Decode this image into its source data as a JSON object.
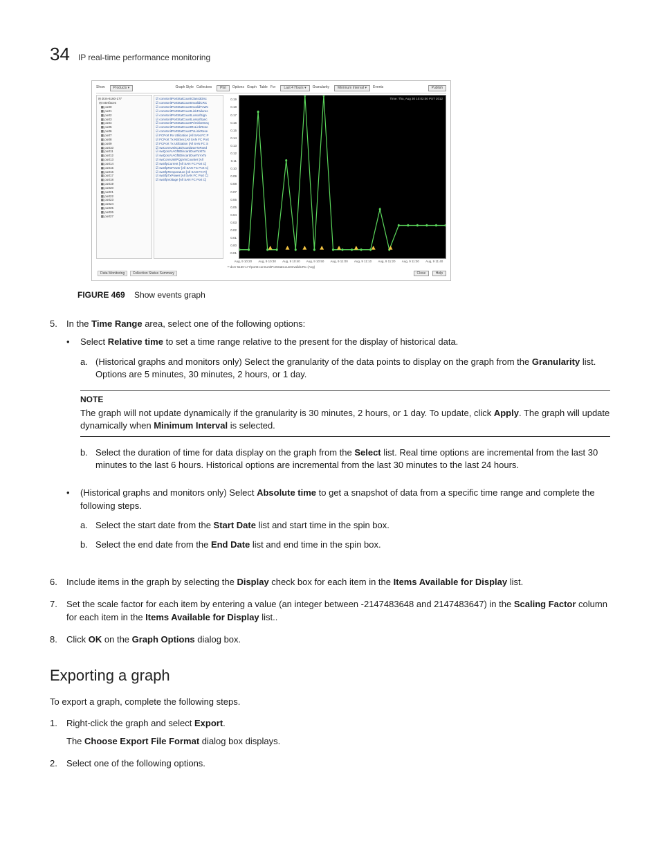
{
  "page_number": "34",
  "header_title": "IP real-time performance monitoring",
  "figure": {
    "toolbar_left": [
      "Show",
      "Products ▾"
    ],
    "toolbar_mid": [
      "Graph Style",
      "Collectors"
    ],
    "toolbar_mid2": "Plot",
    "toolbar_right": [
      "Options",
      "Graph",
      "Table",
      "For",
      "Last 4 Hours ▾",
      "Granularity",
      "Minimum Interval ▾",
      "",
      "Events"
    ],
    "publish_btn": "Publish",
    "time_label": "Time: Thu, Aug 30 10:02:00 PST 2012",
    "tree_root": "dcm-6160-177",
    "tree_group": "Interfaces",
    "tree_ports": [
      "port0",
      "port1",
      "port2",
      "port3",
      "port4",
      "port5",
      "port6",
      "port7",
      "port8",
      "port9",
      "port10",
      "port11",
      "port12",
      "port13",
      "port14",
      "port15",
      "port16",
      "port17",
      "port18",
      "port19",
      "port20",
      "port21",
      "port22",
      "port23",
      "port24",
      "port25",
      "port26",
      "port27"
    ],
    "list_items": [
      "connUnitPortStatCountClass3Disc",
      "connUnitPortStatCountInvalidCRC",
      "connUnitPortStatCountInvalidTxWo",
      "connUnitPortStatCountLinkFailures",
      "connUnitPortStatCountLossofSign",
      "connUnitPortStatCountLossofSync",
      "connUnitPortStatCountPrimitiveSeq",
      "connUnitPortStatCountRxLinkRese",
      "connUnitPortStatCountTxLinkRese",
      "FCPort Rx Utilization [All SAN FC P",
      "FCPort Tx KB/Sec [All SAN FC Port",
      "FCPort Tx Utilization [All SAN FC S",
      "swConnUnitC3DiscardDueToRxed",
      "swQosVcAGfBDiscardDueToXtTo",
      "swQosVcAGfBDiscardDueToYxTo",
      "swConnUnitPQgVmCounter [All",
      "swSfpCurrent [All SAN FC Port C]",
      "swSfpRxPower [All SAN FC Port C]",
      "swSfpTemperature [All SAN FC R]",
      "swSfpTxPower [All SAN FC Port C]",
      "swSfpVoltage [All SAN FC Port C]"
    ],
    "y_ticks": [
      "0.19",
      "0.18",
      "0.17",
      "0.16",
      "0.15",
      "0.14",
      "0.13",
      "0.12",
      "0.11",
      "0.10",
      "0.09",
      "0.08",
      "0.07",
      "0.06",
      "0.05",
      "0.04",
      "0.03",
      "0.02",
      "0.01",
      "0.00",
      "-0.01"
    ],
    "x_ticks": [
      "Aug, 9 10:20",
      "Aug, 9 10:30",
      "Aug, 9 10:40",
      "Aug, 9 10:50",
      "Aug, 9 11:00",
      "Aug, 9 11:10",
      "Aug, 9 11:20",
      "Aug, 9 11:30",
      "Aug, 9 11:40"
    ],
    "legend": "dcm-6160-177/port0:connUnitPortStatCountInvalidCRC (Avg)",
    "tabs": [
      "Data Monitoring",
      "Collection Status Summary"
    ],
    "close_btn": "Close",
    "help_btn": "Help"
  },
  "figcaption_lead": "FIGURE 469",
  "figcaption_text": "Show events graph",
  "chart_data": {
    "type": "line",
    "title": "Show events graph",
    "ylabel": "",
    "ylim": [
      -0.01,
      0.19
    ],
    "series": [
      {
        "name": "dcm-6160-177/port0:connUnitPortStatCountInvalidCRC (Avg)",
        "x": [
          "Aug 9 10:20",
          "Aug 9 10:24",
          "Aug 9 10:27",
          "Aug 9 10:28",
          "Aug 9 10:33",
          "Aug 9 10:40",
          "Aug 9 10:48",
          "Aug 9 10:52",
          "Aug 9 10:55",
          "Aug 9 10:57",
          "Aug 9 11:00",
          "Aug 9 11:03",
          "Aug 9 11:06",
          "Aug 9 11:08",
          "Aug 9 11:10",
          "Aug 9 11:14",
          "Aug 9 11:16",
          "Aug 9 11:20",
          "Aug 9 11:24",
          "Aug 9 11:28",
          "Aug 9 11:32",
          "Aug 9 11:36",
          "Aug 9 11:40"
        ],
        "values": [
          0.0,
          0.0,
          0.17,
          0.0,
          0.0,
          0.11,
          0.0,
          0.19,
          0.0,
          0.19,
          0.0,
          0.0,
          0.0,
          0.0,
          0.0,
          0.05,
          0.0,
          0.03,
          0.03,
          0.03,
          0.03,
          0.03,
          0.03
        ]
      }
    ],
    "event_markers_x": [
      "Aug 9 10:25",
      "Aug 9 10:33",
      "Aug 9 10:54",
      "Aug 9 10:58",
      "Aug 9 11:02",
      "Aug 9 11:04",
      "Aug 9 11:07",
      "Aug 9 11:10"
    ]
  },
  "step5": {
    "num": "5.",
    "lead_a": "In the ",
    "bold_1": "Time Range",
    "lead_b": " area, select one of the following options:",
    "b1_a": "Select ",
    "b1_bold": "Relative time",
    "b1_b": " to set a time range relative to the present for the display of historical data.",
    "a_lead": "(Historical graphs and monitors only) Select the granularity of the data points to display on the graph from the ",
    "a_bold": "Granularity",
    "a_tail": " list. Options are 5 minutes, 30 minutes, 2 hours, or 1 day.",
    "note_label": "NOTE",
    "note_a": "The graph will not update dynamically if the granularity is 30 minutes, 2 hours, or 1 day. To update, click ",
    "note_bold1": "Apply",
    "note_mid": ". The graph will update dynamically when ",
    "note_bold2": "Minimum Interval",
    "note_tail": " is selected.",
    "b_lead": "Select the duration of time for data display on the graph from the ",
    "b_bold": "Select",
    "b_tail": " list. Real time options are incremental from the last 30 minutes to the last 6 hours. Historical options are incremental from the last 30 minutes to the last 24 hours.",
    "b2_a": "(Historical graphs and monitors only) Select ",
    "b2_bold": "Absolute time",
    "b2_b": " to get a snapshot of data from a specific time range and complete the following steps.",
    "b2a_lead": "Select the start date from the ",
    "b2a_bold": "Start Date",
    "b2a_tail": " list and start time in the spin box.",
    "b2b_lead": "Select the end date from the ",
    "b2b_bold": "End Date",
    "b2b_tail": " list and end time in the spin box."
  },
  "step6": {
    "num": "6.",
    "a": "Include items in the graph by selecting the ",
    "bold1": "Display",
    "b": " check box for each item in the ",
    "bold2": "Items Available for Display",
    "c": " list."
  },
  "step7": {
    "num": "7.",
    "a": "Set the scale factor for each item by entering a value (an integer between -2147483648 and 2147483647) in the ",
    "bold1": "Scaling Factor",
    "b": " column for each item in the ",
    "bold2": "Items Available for Display",
    "c": " list.."
  },
  "step8": {
    "num": "8.",
    "a": "Click ",
    "bold1": "OK",
    "b": " on the ",
    "bold2": "Graph Options",
    "c": " dialog box."
  },
  "section2_title": "Exporting a graph",
  "section2_intro": "To export a graph, complete the following steps.",
  "ex1": {
    "num": "1.",
    "a": "Right-click the graph and select ",
    "bold": "Export",
    "b": ".",
    "line2a": "The ",
    "line2bold": "Choose Export File Format",
    "line2b": " dialog box displays."
  },
  "ex2": {
    "num": "2.",
    "text": "Select one of the following options."
  }
}
